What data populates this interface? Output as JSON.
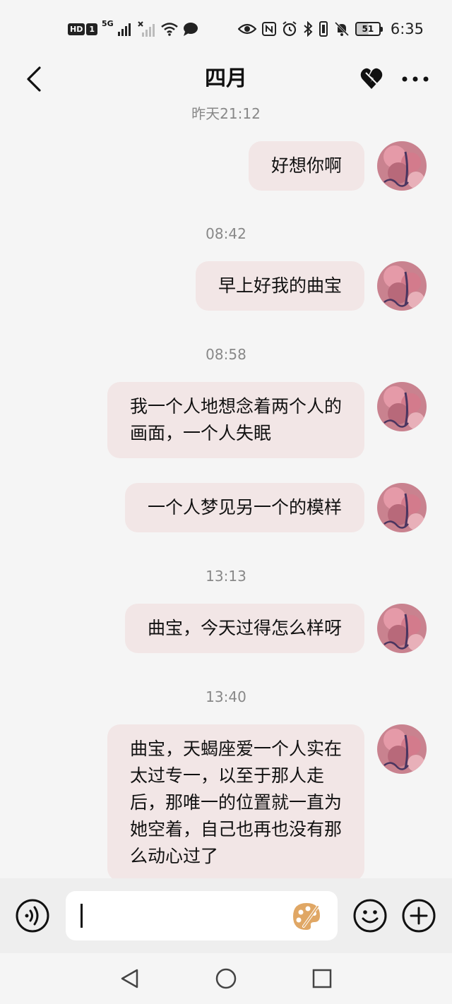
{
  "status_bar": {
    "hd_label": "HD",
    "sim_label": "1",
    "network_label": "5G",
    "battery_level": "51",
    "time": "6:35"
  },
  "header": {
    "title": "四月",
    "back_icon": "chevron-left-icon",
    "heart_icon": "broken-heart-icon",
    "more_icon": "more-dots-icon"
  },
  "messages": [
    {
      "timestamp": "昨天21:12",
      "text": "好想你啊"
    },
    {
      "timestamp": "08:42",
      "text": "早上好我的曲宝"
    },
    {
      "timestamp": "08:58",
      "text": "我一个人地想念着两个人的\n画面，一个人失眠"
    },
    {
      "timestamp": "",
      "text": "一个人梦见另一个的模样"
    },
    {
      "timestamp": "13:13",
      "text": "曲宝，今天过得怎么样呀"
    },
    {
      "timestamp": "13:40",
      "text": "曲宝，天蝎座爱一个人实在\n太过专一，以至于那人走\n后，那唯一的位置就一直为\n她空着，自己也再也没有那\n么动心过了"
    }
  ],
  "input_bar": {
    "value": "",
    "voice_icon": "voice-icon",
    "palette_icon": "palette-icon",
    "emoji_icon": "emoji-icon",
    "plus_icon": "plus-icon"
  },
  "colors": {
    "bubble": "#f2e6e6",
    "background": "#f5f5f5",
    "palette_accent": "#e0a765"
  }
}
